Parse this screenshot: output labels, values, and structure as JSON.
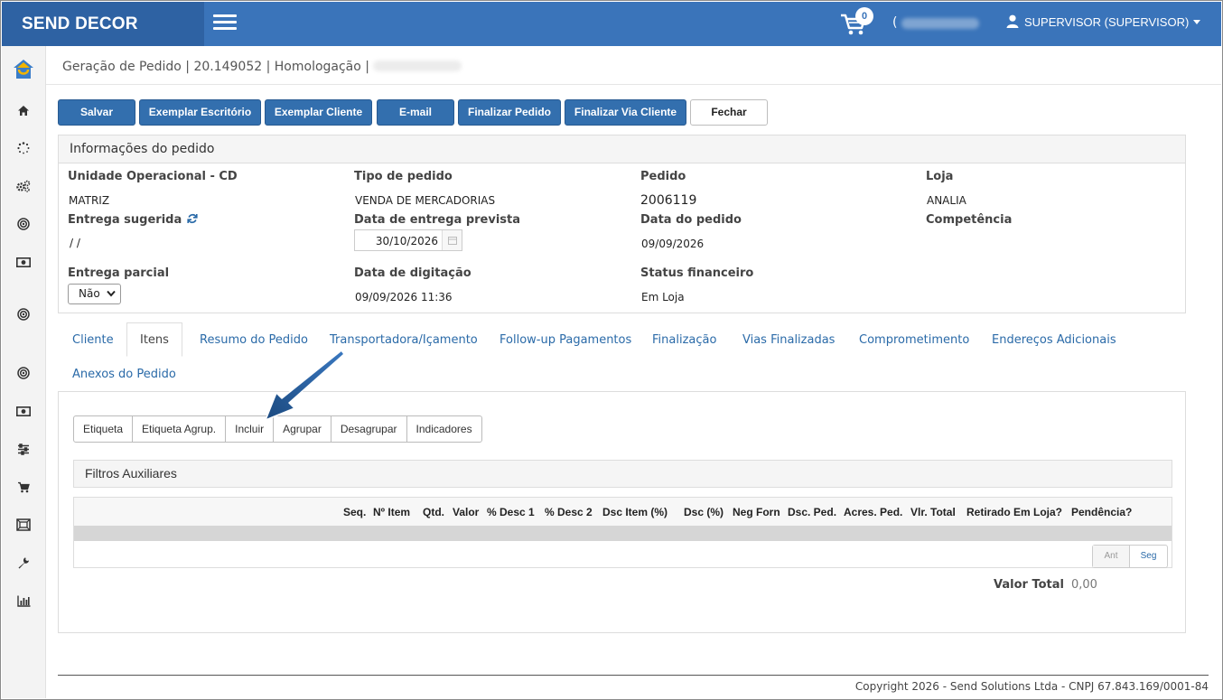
{
  "header": {
    "brand": "SEND DECOR",
    "cart_count": "0",
    "user_paren": "(",
    "user_label": "SUPERVISOR (SUPERVISOR)"
  },
  "page": {
    "title": "Geração de Pedido | 20.149052 | Homologação |"
  },
  "toolbar": {
    "buttons": [
      "Salvar",
      "Exemplar Escritório",
      "Exemplar Cliente",
      "E-mail",
      "Finalizar Pedido",
      "Finalizar Via Cliente",
      "Fechar"
    ]
  },
  "order_info": {
    "heading": "Informações do pedido",
    "unidade_label": "Unidade Operacional - CD",
    "unidade_value": "MATRIZ",
    "tipo_label": "Tipo de pedido",
    "tipo_value": "VENDA DE MERCADORIAS",
    "pedido_label": "Pedido",
    "pedido_value": "2006119",
    "loja_label": "Loja",
    "loja_value": "ANALIA",
    "entrega_sugerida_label": "Entrega sugerida",
    "entrega_sugerida_value": "/ /",
    "data_entrega_label": "Data de entrega prevista",
    "data_entrega_value": "30/10/2026",
    "data_pedido_label": "Data do pedido",
    "data_pedido_value": "09/09/2026",
    "competencia_label": "Competência",
    "entrega_parcial_label": "Entrega parcial",
    "entrega_parcial_value": "Não",
    "data_digitacao_label": "Data de digitação",
    "data_digitacao_value": "09/09/2026 11:36",
    "status_financeiro_label": "Status financeiro",
    "status_financeiro_value": "Em Loja"
  },
  "tabs": [
    "Cliente",
    "Itens",
    "Resumo do Pedido",
    "Transportadora/Içamento",
    "Follow-up Pagamentos",
    "Finalização",
    "Vias Finalizadas",
    "Comprometimento",
    "Endereços Adicionais",
    "Anexos do Pedido"
  ],
  "active_tab": "Itens",
  "items": {
    "actions": [
      "Etiqueta",
      "Etiqueta Agrup.",
      "Incluir",
      "Agrupar",
      "Desagrupar",
      "Indicadores"
    ],
    "filters_label": "Filtros Auxiliares",
    "columns": [
      "Seq.",
      "Nº Item",
      "Qtd.",
      "Valor",
      "% Desc 1",
      "% Desc 2",
      "Dsc Item (%)",
      "Dsc (%)",
      "Neg Forn",
      "Dsc. Ped.",
      "Acres. Ped.",
      "Vlr. Total",
      "Retirado Em Loja?",
      "Pendência?"
    ],
    "pager_prev": "Ant",
    "pager_next": "Seg",
    "total_label": "Valor Total",
    "total_value": "0,00"
  },
  "footer": {
    "copyright": "Copyright 2026 - Send Solutions Ltda - CNPJ 67.843.169/0001-84"
  },
  "colors": {
    "header_bg": "#3a74ba",
    "brand_bg": "#2e62a3",
    "button_bg": "#336fae",
    "link": "#2a6aa8",
    "arrow": "#1f4f86"
  }
}
